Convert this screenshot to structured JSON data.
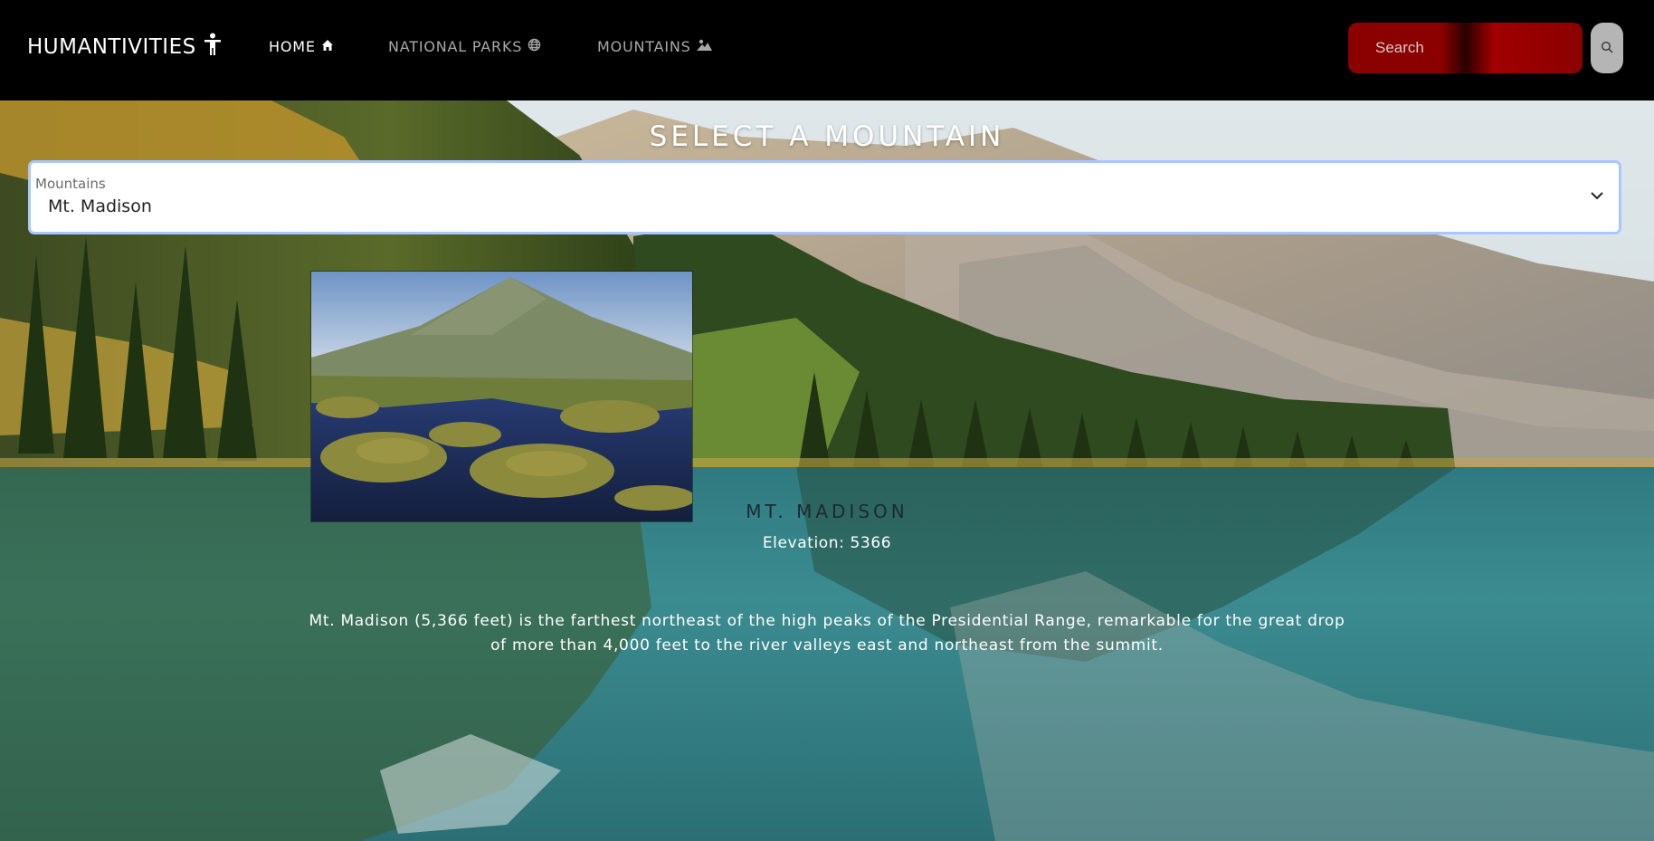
{
  "brand": {
    "name": "HUMANTIVITIES",
    "icon": "person-accessibility-icon"
  },
  "nav": {
    "items": [
      {
        "label": "HOME",
        "icon": "house-icon",
        "active": true
      },
      {
        "label": "NATIONAL PARKS",
        "icon": "globe-icon",
        "active": false
      },
      {
        "label": "MOUNTAINS",
        "icon": "landscape-icon",
        "active": false
      }
    ]
  },
  "search": {
    "placeholder": "Search",
    "button_icon": "search-icon"
  },
  "page": {
    "title": "SELECT A MOUNTAIN"
  },
  "select": {
    "label": "Mountains",
    "value": "Mt. Madison"
  },
  "mountain": {
    "name": "MT. MADISON",
    "elevation": "Elevation: 5366",
    "description": "Mt. Madison (5,366 feet) is the farthest northeast of the high peaks of the Presidential Range, remarkable for the great drop of more than 4,000 feet to the river valleys east and northeast from the summit."
  },
  "colors": {
    "navbar": "#000000",
    "search_bg": "#8b0000",
    "search_btn": "#b5b5b5",
    "accent_focus": "#a9c6ff"
  }
}
